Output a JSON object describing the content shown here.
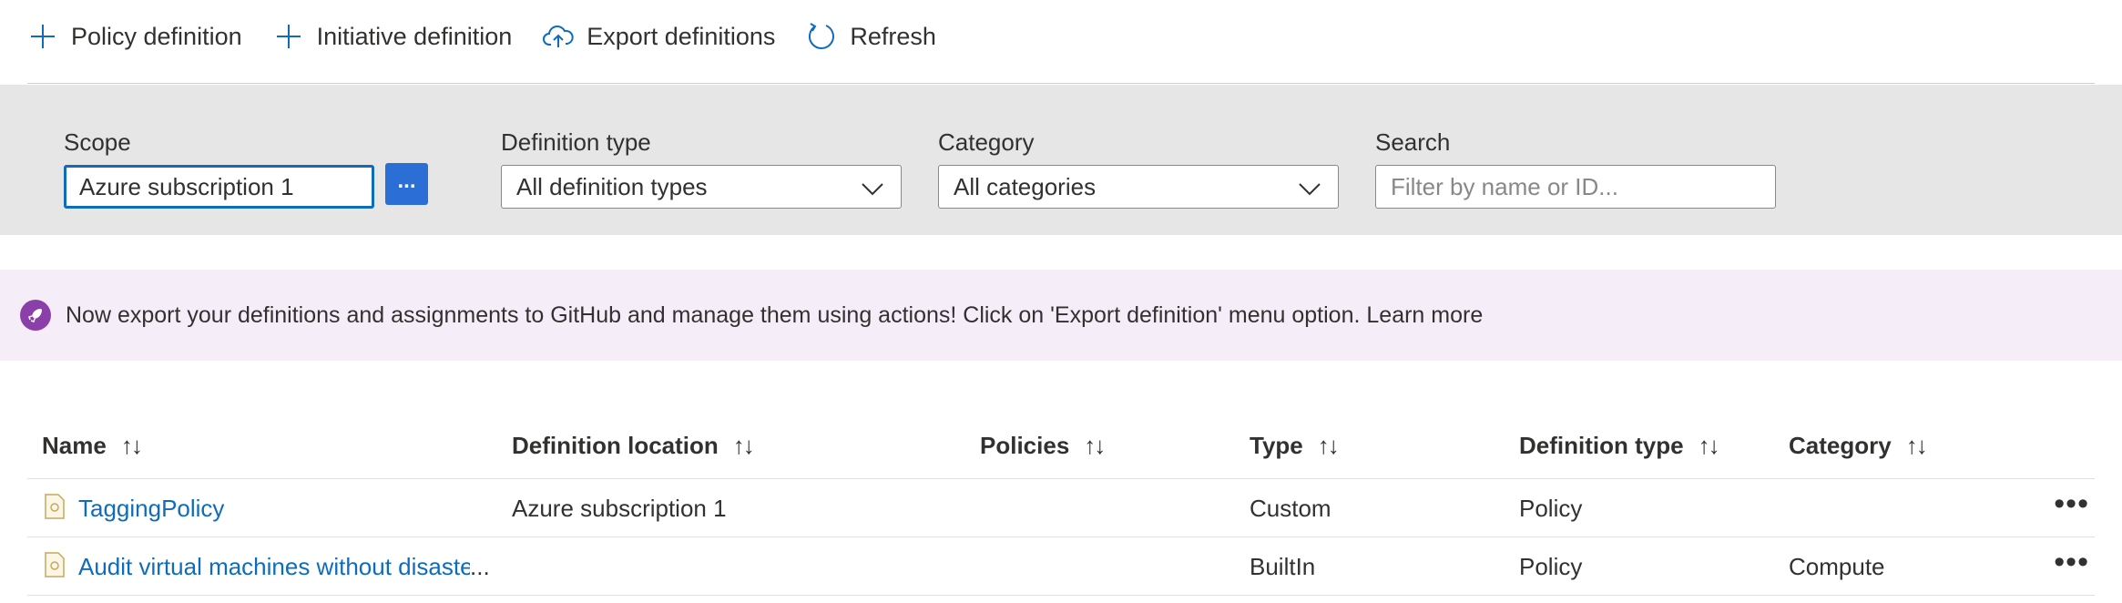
{
  "toolbar": {
    "policy_definition": "Policy definition",
    "initiative_definition": "Initiative definition",
    "export_definitions": "Export definitions",
    "refresh": "Refresh"
  },
  "filters": {
    "scope_label": "Scope",
    "scope_value": "Azure subscription 1",
    "scope_more": "...",
    "definition_type_label": "Definition type",
    "definition_type_value": "All definition types",
    "category_label": "Category",
    "category_value": "All categories",
    "search_label": "Search",
    "search_placeholder": "Filter by name or ID..."
  },
  "banner": {
    "message": "Now export your definitions and assignments to GitHub and manage them using actions! Click on 'Export definition' menu option. Learn more"
  },
  "table": {
    "columns": {
      "name": "Name",
      "definition_location": "Definition location",
      "policies": "Policies",
      "type": "Type",
      "definition_type": "Definition type",
      "category": "Category"
    },
    "sort_glyph": "↑↓",
    "row_menu": "•••",
    "rows": [
      {
        "name": "TaggingPolicy",
        "definition_location": "Azure subscription 1",
        "policies": "",
        "type": "Custom",
        "definition_type": "Policy",
        "category": ""
      },
      {
        "name": "Audit virtual machines without disaste",
        "name_ellipsis": "...",
        "definition_location": "",
        "policies": "",
        "type": "BuiltIn",
        "definition_type": "Policy",
        "category": "Compute"
      }
    ]
  },
  "colors": {
    "accent": "#0f6cbd",
    "button_blue": "#2b6fd6",
    "filter_band": "#e6e6e6",
    "banner_bg": "#f5eef8",
    "banner_icon": "#8b3fa8"
  }
}
